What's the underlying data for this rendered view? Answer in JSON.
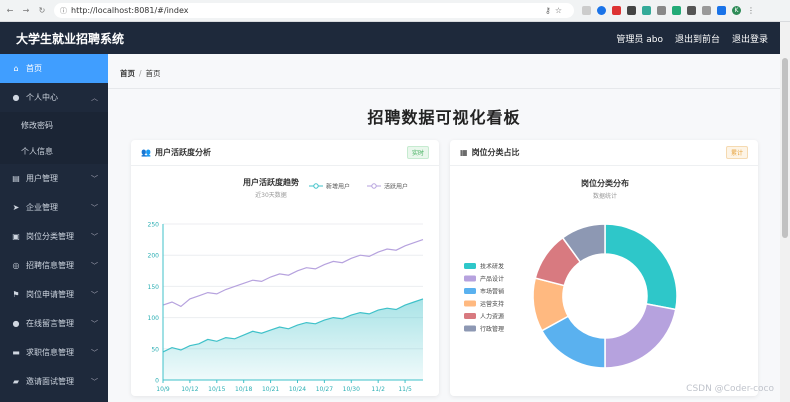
{
  "browser": {
    "url": "http://localhost:8081/#/index",
    "avatar_letter": "K"
  },
  "topbar": {
    "logo": "大学生就业招聘系统",
    "admin": "管理员 abo",
    "back_front": "退出到前台",
    "logout": "退出登录"
  },
  "sidebar": {
    "items": [
      {
        "label": "首页",
        "icon": "home-icon",
        "active": true
      },
      {
        "label": "个人中心",
        "icon": "user-icon",
        "expanded": true
      },
      {
        "label": "修改密码",
        "sub": true
      },
      {
        "label": "个人信息",
        "sub": true
      },
      {
        "label": "用户管理",
        "icon": "clipboard-icon"
      },
      {
        "label": "企业管理",
        "icon": "send-icon"
      },
      {
        "label": "岗位分类管理",
        "icon": "ticket-icon"
      },
      {
        "label": "招聘信息管理",
        "icon": "globe-icon"
      },
      {
        "label": "岗位申请管理",
        "icon": "flag-icon"
      },
      {
        "label": "在线留言管理",
        "icon": "person-icon"
      },
      {
        "label": "求职信息管理",
        "icon": "briefcase-icon"
      },
      {
        "label": "邀请面试管理",
        "icon": "chat-icon"
      }
    ]
  },
  "breadcrumb": {
    "root": "首页",
    "sep": "/",
    "current": "首页"
  },
  "page_title": "招聘数据可视化看板",
  "cards": {
    "activity": {
      "title": "用户活跃度分析",
      "badge": "实时"
    },
    "category": {
      "title": "岗位分类占比",
      "badge": "累计"
    }
  },
  "chart_data": [
    {
      "type": "line",
      "title": "用户活跃度趋势",
      "subtitle": "近30天数据",
      "x": [
        "10/9",
        "10/10",
        "10/11",
        "10/12",
        "10/13",
        "10/14",
        "10/15",
        "10/16",
        "10/17",
        "10/18",
        "10/19",
        "10/20",
        "10/21",
        "10/22",
        "10/23",
        "10/24",
        "10/25",
        "10/26",
        "10/27",
        "10/28",
        "10/29",
        "10/30",
        "10/31",
        "11/1",
        "11/2",
        "11/3",
        "11/4",
        "11/5",
        "11/6",
        "11/7"
      ],
      "xticks": [
        "10/9",
        "10/12",
        "10/15",
        "10/18",
        "10/21",
        "10/24",
        "10/27",
        "10/30",
        "11/2",
        "11/5"
      ],
      "ylim": [
        0,
        250
      ],
      "yticks": [
        0,
        50,
        100,
        150,
        200,
        250
      ],
      "series": [
        {
          "name": "新增用户",
          "color": "#3fc1c9",
          "area": true,
          "values": [
            45,
            52,
            48,
            55,
            58,
            65,
            62,
            68,
            66,
            72,
            78,
            75,
            80,
            85,
            82,
            88,
            92,
            90,
            96,
            100,
            98,
            104,
            108,
            106,
            112,
            115,
            113,
            120,
            125,
            130
          ]
        },
        {
          "name": "活跃用户",
          "color": "#b6a2de",
          "area": false,
          "values": [
            120,
            125,
            118,
            130,
            135,
            140,
            138,
            145,
            150,
            155,
            160,
            158,
            165,
            170,
            168,
            175,
            180,
            178,
            185,
            190,
            188,
            195,
            200,
            198,
            205,
            210,
            208,
            215,
            220,
            225
          ]
        }
      ]
    },
    {
      "type": "pie",
      "title": "岗位分类分布",
      "subtitle": "数据统计",
      "donut": true,
      "slices": [
        {
          "name": "技术研发",
          "value": 28,
          "color": "#2ec7c9"
        },
        {
          "name": "产品设计",
          "value": 22,
          "color": "#b6a2de"
        },
        {
          "name": "市场营销",
          "value": 17,
          "color": "#5ab1ef"
        },
        {
          "name": "运营支持",
          "value": 12,
          "color": "#ffb980"
        },
        {
          "name": "人力资源",
          "value": 11,
          "color": "#d87a80"
        },
        {
          "name": "行政管理",
          "value": 10,
          "color": "#8d98b3"
        }
      ]
    }
  ],
  "watermark": "CSDN @Coder-coco"
}
